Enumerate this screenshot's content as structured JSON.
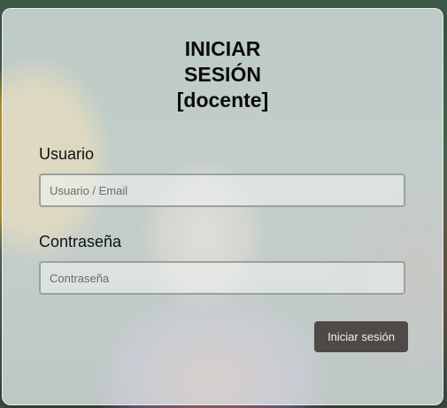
{
  "login": {
    "title_lines": [
      "INICIAR",
      "SESIÓN",
      "[docente]"
    ],
    "username": {
      "label": "Usuario",
      "placeholder": "Usuario / Email",
      "value": ""
    },
    "password": {
      "label": "Contraseña",
      "placeholder": "Contraseña",
      "value": ""
    },
    "submit_label": "Iniciar sesión"
  },
  "colors": {
    "card_background": "#dee6e6",
    "button_background": "#4e4a47",
    "button_text": "#f2f2f2",
    "field_border": "#9aa1a1"
  }
}
